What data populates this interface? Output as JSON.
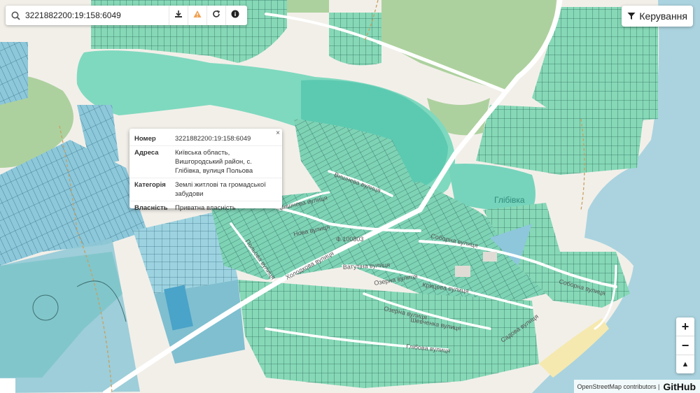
{
  "search": {
    "value": "3221882200:19:158:6049"
  },
  "toolbar": {
    "download_icon": "download-icon",
    "warning_icon": "warning-icon",
    "refresh_icon": "refresh-icon",
    "info_icon": "info-icon"
  },
  "control": {
    "label": "Керування",
    "icon": "filter-icon"
  },
  "popup": {
    "close": "×",
    "rows": [
      {
        "key": "Номер",
        "value": "3221882200:19:158:6049"
      },
      {
        "key": "Адреса",
        "value": "Київська область, Вишгородський район, с. Глібівка, вулиця Польова"
      },
      {
        "key": "Категорія",
        "value": "Землі житлові та громадської забудови"
      },
      {
        "key": "Власність",
        "value": "Приватна власність"
      }
    ]
  },
  "map": {
    "place_label": "Глібівка",
    "parcel_label": "Ф 100803",
    "streets": [
      "Вишнева вулиця",
      "Вишнева вулиця",
      "Нова вулиця",
      "Польова вулиця",
      "Холодкова вулиця",
      "Соборна вулиця",
      "Ватутіна вулиця",
      "Озерна вулиця",
      "Крицева вулиця",
      "Соборна вулиця",
      "Озерна вулиця",
      "Шевченка вулиця",
      "Садова вулиця",
      "Глібова вулиця"
    ]
  },
  "zoom": {
    "in": "+",
    "out": "−",
    "north": "▲"
  },
  "attribution": {
    "osm": "OpenStreetMap contributors |",
    "github": "GitHub"
  },
  "colors": {
    "water": "#aad3df",
    "forest": "#add19e",
    "parcel_green": "#7fd6b6",
    "parcel_blue": "#8ec6dc",
    "road": "#ffffff",
    "lake": "#6fcfb8"
  }
}
